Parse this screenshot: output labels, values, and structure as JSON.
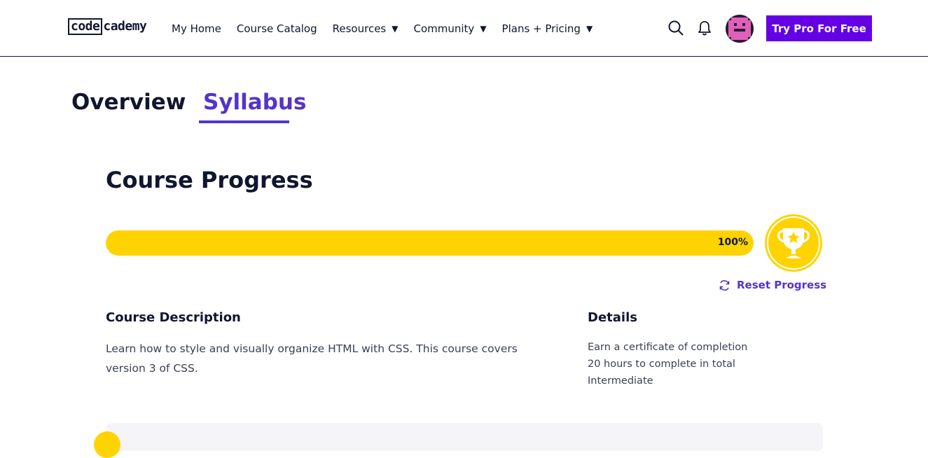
{
  "header": {
    "logo": {
      "boxed": "code",
      "rest": "cademy"
    },
    "nav": [
      {
        "label": "My Home",
        "dropdown": false
      },
      {
        "label": "Course Catalog",
        "dropdown": false
      },
      {
        "label": "Resources",
        "dropdown": true
      },
      {
        "label": "Community",
        "dropdown": true
      },
      {
        "label": "Plans + Pricing",
        "dropdown": true
      }
    ],
    "caret": "▼",
    "icons": [
      "search-icon",
      "bell-icon",
      "avatar"
    ],
    "cta_label": "Try Pro For Free"
  },
  "tabs": [
    {
      "label": "Overview",
      "active": false
    },
    {
      "label": "Syllabus",
      "active": true
    }
  ],
  "progress": {
    "heading": "Course Progress",
    "value_percent": 100,
    "label": "100%",
    "reset_label": "Reset Progress"
  },
  "description": {
    "heading": "Course Description",
    "text": "Learn how to style and visually organize HTML with CSS. This course covers version 3 of CSS."
  },
  "details": {
    "heading": "Details",
    "items": [
      "Earn a certificate of completion",
      "20 hours to complete in total",
      "Intermediate"
    ]
  },
  "colors": {
    "accent": "#5533cc",
    "cta": "#6400e4",
    "progress": "#ffd300",
    "text": "#10162f"
  }
}
